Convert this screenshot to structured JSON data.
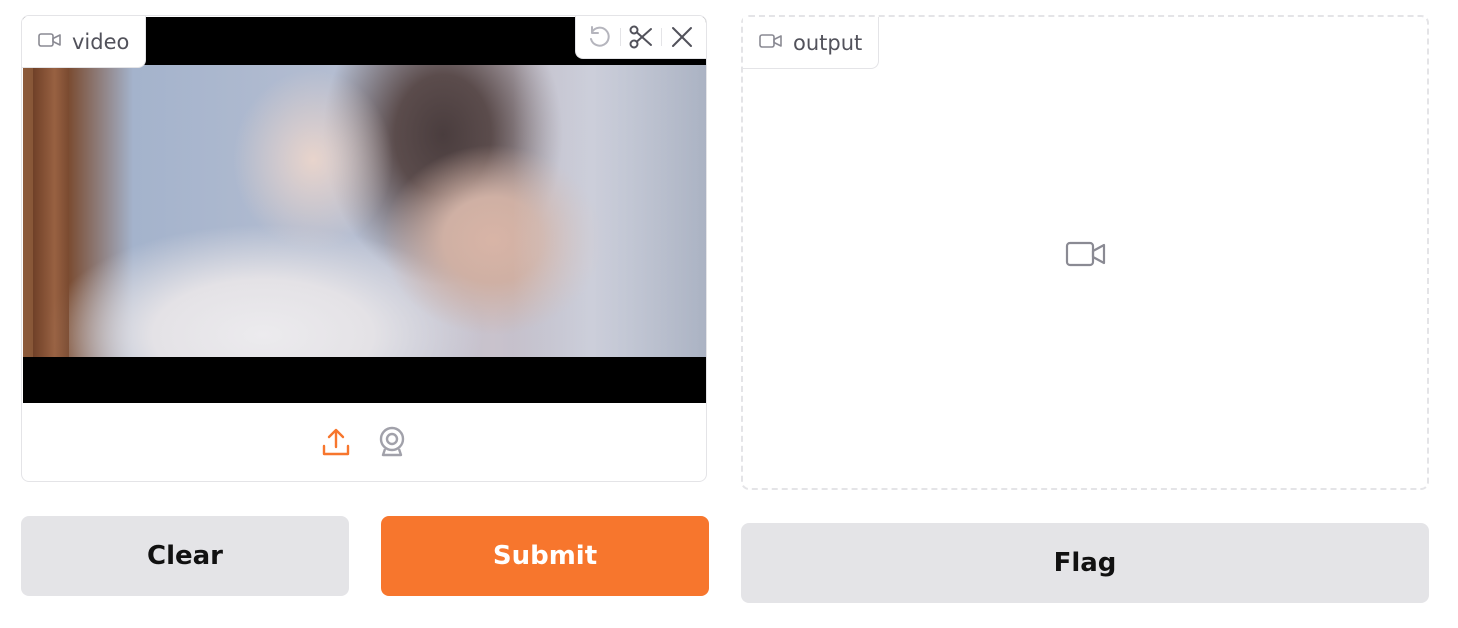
{
  "input_panel": {
    "label": "video",
    "label_icon": "video-camera-icon",
    "toolbar": {
      "undo_icon": "undo-icon",
      "trim_icon": "scissors-icon",
      "close_icon": "close-icon"
    },
    "sources": {
      "upload_icon": "upload-icon",
      "webcam_icon": "webcam-icon"
    }
  },
  "output_panel": {
    "label": "output",
    "label_icon": "video-camera-icon",
    "placeholder_icon": "video-camera-icon"
  },
  "buttons": {
    "clear": "Clear",
    "submit": "Submit",
    "flag": "Flag"
  },
  "colors": {
    "accent": "#f7762d",
    "neutral_button": "#e4e4e7",
    "border": "#e4e4e7",
    "muted_icon": "#a1a1aa"
  }
}
